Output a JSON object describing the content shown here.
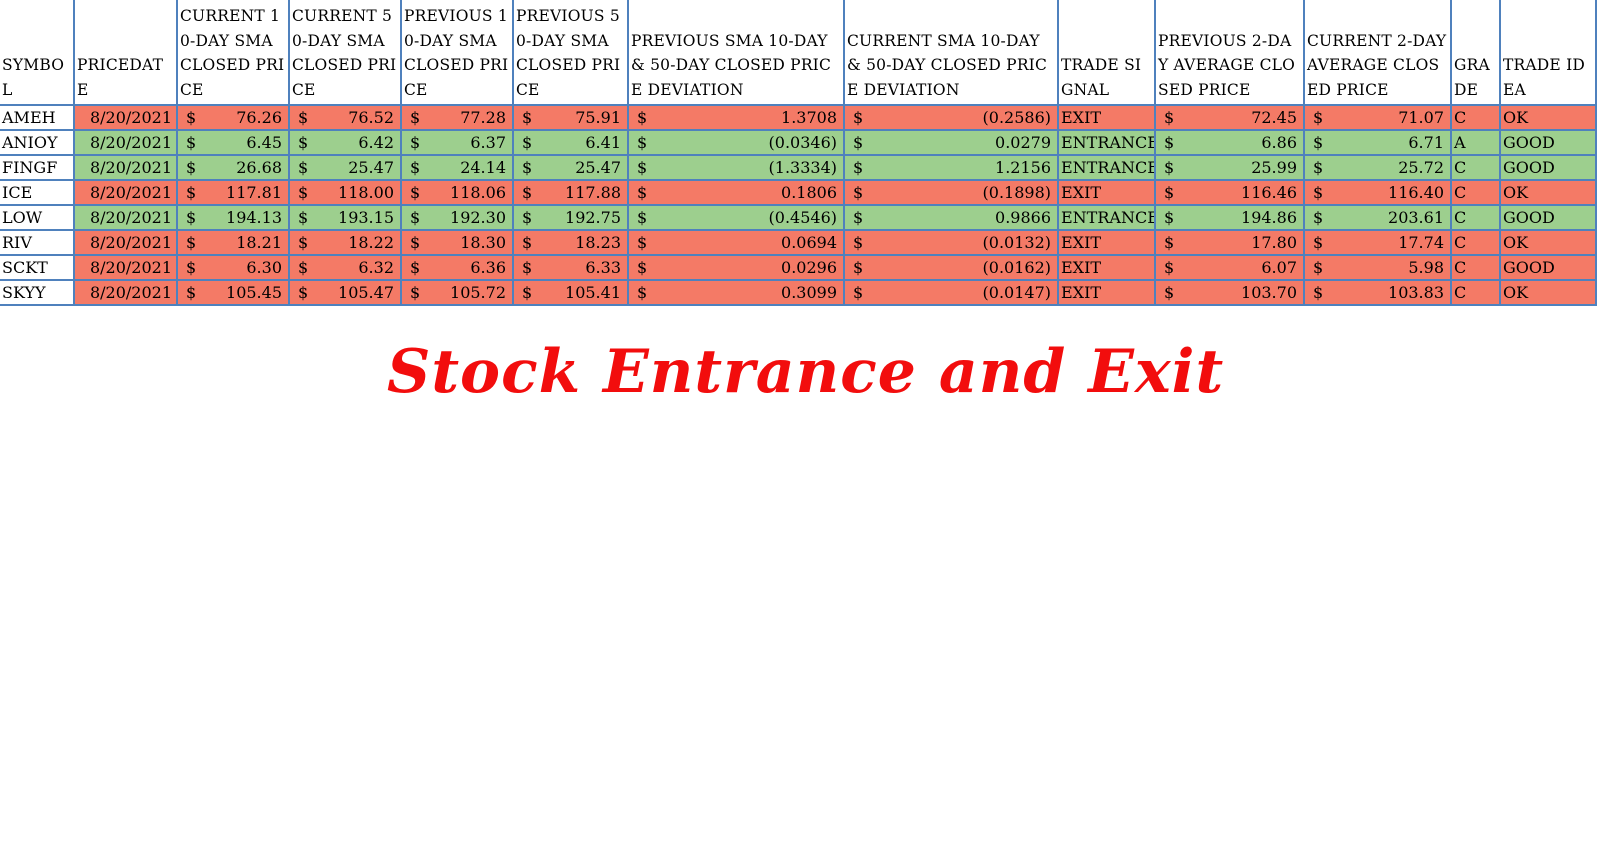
{
  "sheet": {
    "headers": [
      "SYMBOL",
      "PRICEDATE",
      "CURRENT 10-DAY SMA CLOSED PRICE",
      "CURRENT 50-DAY SMA CLOSED PRICE",
      "PREVIOUS 10-DAY SMA CLOSED PRICE",
      "PREVIOUS 50-DAY SMA CLOSED PRICE",
      "PREVIOUS SMA 10-DAY & 50-DAY CLOSED PRICE DEVIATION",
      "CURRENT SMA 10-DAY & 50-DAY CLOSED PRICE DEVIATION",
      "TRADE SIGNAL",
      "PREVIOUS 2-DAY AVERAGE CLOSED PRICE",
      "CURRENT 2-DAY AVERAGE CLOSED PRICE",
      "GRADE",
      "TRADE IDEA"
    ],
    "currency_symbol": "$",
    "rows": [
      {
        "symbol": "AMEH",
        "date": "8/20/2021",
        "cur10": "76.26",
        "cur50": "76.52",
        "prev10": "77.28",
        "prev50": "75.91",
        "prevdev": "1.3708",
        "curdev": "(0.2586)",
        "signal": "EXIT",
        "prev2": "72.45",
        "cur2": "71.07",
        "grade": "C",
        "idea": "OK"
      },
      {
        "symbol": "ANIOY",
        "date": "8/20/2021",
        "cur10": "6.45",
        "cur50": "6.42",
        "prev10": "6.37",
        "prev50": "6.41",
        "prevdev": "(0.0346)",
        "curdev": "0.0279",
        "signal": "ENTRANCE",
        "prev2": "6.86",
        "cur2": "6.71",
        "grade": "A",
        "idea": "GOOD"
      },
      {
        "symbol": "FINGF",
        "date": "8/20/2021",
        "cur10": "26.68",
        "cur50": "25.47",
        "prev10": "24.14",
        "prev50": "25.47",
        "prevdev": "(1.3334)",
        "curdev": "1.2156",
        "signal": "ENTRANCE",
        "prev2": "25.99",
        "cur2": "25.72",
        "grade": "C",
        "idea": "GOOD"
      },
      {
        "symbol": "ICE",
        "date": "8/20/2021",
        "cur10": "117.81",
        "cur50": "118.00",
        "prev10": "118.06",
        "prev50": "117.88",
        "prevdev": "0.1806",
        "curdev": "(0.1898)",
        "signal": "EXIT",
        "prev2": "116.46",
        "cur2": "116.40",
        "grade": "C",
        "idea": "OK"
      },
      {
        "symbol": "LOW",
        "date": "8/20/2021",
        "cur10": "194.13",
        "cur50": "193.15",
        "prev10": "192.30",
        "prev50": "192.75",
        "prevdev": "(0.4546)",
        "curdev": "0.9866",
        "signal": "ENTRANCE",
        "prev2": "194.86",
        "cur2": "203.61",
        "grade": "C",
        "idea": "GOOD"
      },
      {
        "symbol": "RIV",
        "date": "8/20/2021",
        "cur10": "18.21",
        "cur50": "18.22",
        "prev10": "18.30",
        "prev50": "18.23",
        "prevdev": "0.0694",
        "curdev": "(0.0132)",
        "signal": "EXIT",
        "prev2": "17.80",
        "cur2": "17.74",
        "grade": "C",
        "idea": "OK"
      },
      {
        "symbol": "SCKT",
        "date": "8/20/2021",
        "cur10": "6.30",
        "cur50": "6.32",
        "prev10": "6.36",
        "prev50": "6.33",
        "prevdev": "0.0296",
        "curdev": "(0.0162)",
        "signal": "EXIT",
        "prev2": "6.07",
        "cur2": "5.98",
        "grade": "C",
        "idea": "GOOD"
      },
      {
        "symbol": "SKYY",
        "date": "8/20/2021",
        "cur10": "105.45",
        "cur50": "105.47",
        "prev10": "105.72",
        "prev50": "105.41",
        "prevdev": "0.3099",
        "curdev": "(0.0147)",
        "signal": "EXIT",
        "prev2": "103.70",
        "cur2": "103.83",
        "grade": "C",
        "idea": "OK"
      }
    ]
  },
  "caption": "Stock Entrance and Exit",
  "colors": {
    "exit_fill": "#f47a66",
    "entrance_fill": "#9dcf8e",
    "grid_border": "#4f81bd",
    "caption_text": "#f20d0d"
  }
}
